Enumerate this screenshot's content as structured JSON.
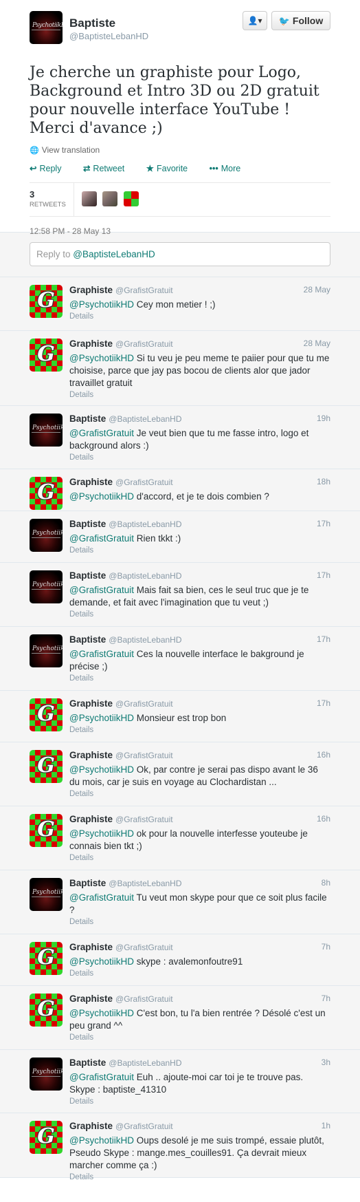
{
  "main": {
    "name": "Baptiste",
    "handle": "@BaptisteLebanHD",
    "avatar_text": "PsychotiikHD",
    "user_button": "👤▾",
    "follow_label": "Follow",
    "text": "Je cherche un graphiste pour Logo, Background et Intro 3D ou 2D gratuit pour nouvelle interface YouTube ! Merci d'avance ;)",
    "translate": "View translation",
    "actions": {
      "reply": "Reply",
      "retweet": "Retweet",
      "favorite": "Favorite",
      "more": "More"
    },
    "retweets_count": "3",
    "retweets_label": "RETWEETS",
    "timestamp": "12:58 PM - 28 May 13"
  },
  "reply": {
    "prefix": "Reply to ",
    "mention": "@BaptisteLebanHD"
  },
  "replies": [
    {
      "avatar": "g",
      "name": "Graphiste",
      "handle": "@GrafistGratuit",
      "time": "28 May",
      "mention": "@PsychotiikHD",
      "text": " Cey mon metier ! ;)",
      "details": "Details"
    },
    {
      "avatar": "g",
      "name": "Graphiste",
      "handle": "@GrafistGratuit",
      "time": "28 May",
      "mention": "@PsychotiikHD",
      "text": " Si tu veu je peu meme te paiier pour que tu me choisise, parce que jay pas bocou de clients alor que jador travaillet gratuit",
      "details": "Details"
    },
    {
      "avatar": "b",
      "name": "Baptiste",
      "handle": "@BaptisteLebanHD",
      "time": "19h",
      "mention": "@GrafistGratuit",
      "text": " Je veut bien que tu me fasse intro, logo et background alors :)",
      "details": "Details"
    },
    {
      "avatar": "g",
      "name": "Graphiste",
      "handle": "@GrafistGratuit",
      "time": "18h",
      "mention": "@PsychotiikHD",
      "text": " d'accord, et je te dois combien ?",
      "details": ""
    },
    {
      "avatar": "b",
      "name": "Baptiste",
      "handle": "@BaptisteLebanHD",
      "time": "17h",
      "mention": "@GrafistGratuit",
      "text": " Rien tkkt :)",
      "details": "Details"
    },
    {
      "avatar": "b",
      "name": "Baptiste",
      "handle": "@BaptisteLebanHD",
      "time": "17h",
      "mention": "@GrafistGratuit",
      "text": " Mais fait sa bien, ces le seul truc que je te demande, et fait avec l'imagination que tu veut ;)",
      "details": "Details"
    },
    {
      "avatar": "b",
      "name": "Baptiste",
      "handle": "@BaptisteLebanHD",
      "time": "17h",
      "mention": "@GrafistGratuit",
      "text": " Ces la nouvelle interface le bakground je précise ;)",
      "details": "Details"
    },
    {
      "avatar": "g",
      "name": "Graphiste",
      "handle": "@GrafistGratuit",
      "time": "17h",
      "mention": "@PsychotiikHD",
      "text": " Monsieur est trop bon",
      "details": "Details"
    },
    {
      "avatar": "g",
      "name": "Graphiste",
      "handle": "@GrafistGratuit",
      "time": "16h",
      "mention": "@PsychotiikHD",
      "text": " Ok, par contre je serai pas dispo avant le 36 du mois, car je suis en voyage au Clochardistan ...",
      "details": "Details"
    },
    {
      "avatar": "g",
      "name": "Graphiste",
      "handle": "@GrafistGratuit",
      "time": "16h",
      "mention": "@PsychotiikHD",
      "text": " ok pour la nouvelle interfesse youteube je connais bien tkt ;)",
      "details": "Details"
    },
    {
      "avatar": "b",
      "name": "Baptiste",
      "handle": "@BaptisteLebanHD",
      "time": "8h",
      "mention": "@GrafistGratuit",
      "text": " Tu veut mon skype pour que ce soit plus facile ?",
      "details": "Details"
    },
    {
      "avatar": "g",
      "name": "Graphiste",
      "handle": "@GrafistGratuit",
      "time": "7h",
      "mention": "@PsychotiikHD",
      "text": " skype : avalemonfoutre91",
      "details": "Details"
    },
    {
      "avatar": "g",
      "name": "Graphiste",
      "handle": "@GrafistGratuit",
      "time": "7h",
      "mention": "@PsychotiikHD",
      "text": " C'est bon, tu l'a bien rentrée ? Désolé c'est un peu grand ^^",
      "details": "Details"
    },
    {
      "avatar": "b",
      "name": "Baptiste",
      "handle": "@BaptisteLebanHD",
      "time": "3h",
      "mention": "@GrafistGratuit",
      "text": " Euh .. ajoute-moi car toi je te trouve pas. Skype : baptiste_41310",
      "details": "Details"
    },
    {
      "avatar": "g",
      "name": "Graphiste",
      "handle": "@GrafistGratuit",
      "time": "1h",
      "mention": "@PsychotiikHD",
      "text": " Oups desolé je me suis trompé, essaie plutôt, Pseudo Skype : mange.mes_couilles91. Ça devrait mieux marcher comme ça :)",
      "details": "Details"
    }
  ]
}
